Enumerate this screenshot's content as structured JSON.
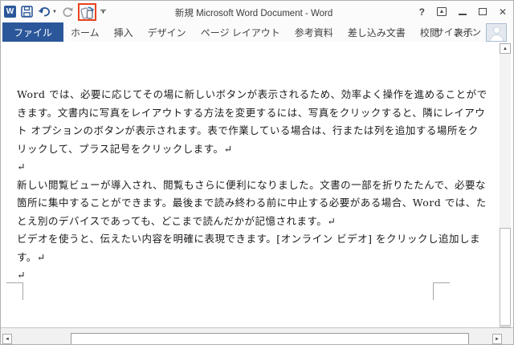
{
  "colors": {
    "accent": "#2b579a",
    "highlight_box": "#e8431f",
    "tab_text": "#444444",
    "document_text": "#1a1a1a"
  },
  "titlebar": {
    "title": "新規 Microsoft Word Document - Word",
    "app_icon_letter": "W",
    "qat_icons": [
      "word-app-icon",
      "save-icon",
      "undo-icon",
      "redo-icon",
      "touch-mouse-mode-icon"
    ],
    "touch_mode_highlighted": true,
    "controls": {
      "help": "?",
      "minimize": "–",
      "close": "✕"
    }
  },
  "ribbon": {
    "tabs": [
      {
        "label": "ファイル",
        "active": true
      },
      {
        "label": "ホーム",
        "active": false
      },
      {
        "label": "挿入",
        "active": false
      },
      {
        "label": "デザイン",
        "active": false
      },
      {
        "label": "ページ レイアウト",
        "active": false
      },
      {
        "label": "参考資料",
        "active": false
      },
      {
        "label": "差し込み文書",
        "active": false
      },
      {
        "label": "校閲",
        "active": false
      },
      {
        "label": "表示",
        "active": false
      }
    ],
    "signin_label": "サインイン"
  },
  "document": {
    "lines": [
      "Word では、必要に応じてその場に新しいボタンが表示されるため、効率よく操作を進めることがで",
      "きます。文書内に写真をレイアウトする方法を変更するには、写真をクリックすると、隣にレイアウ",
      "ト オプションのボタンが表示されます。表で作業している場合は、行または列を追加する場所をク",
      "リックして、プラス記号をクリックします。↵",
      "↵",
      "新しい閲覧ビューが導入され、閲覧もさらに便利になりました。文書の一部を折りたたんで、必要な",
      "箇所に集中することができます。最後まで読み終わる前に中止する必要がある場合、Word では、た",
      "とえ別のデバイスであっても、どこまで読んだかが記憶されます。↵",
      "ビデオを使うと、伝えたい内容を明確に表現できます。[オンライン ビデオ] をクリックし追加しま",
      "す。↵",
      "↵"
    ]
  },
  "scrollbars": {
    "up_arrow": "▲",
    "down_arrow": "▼",
    "left_arrow": "◄",
    "right_arrow": "►"
  }
}
